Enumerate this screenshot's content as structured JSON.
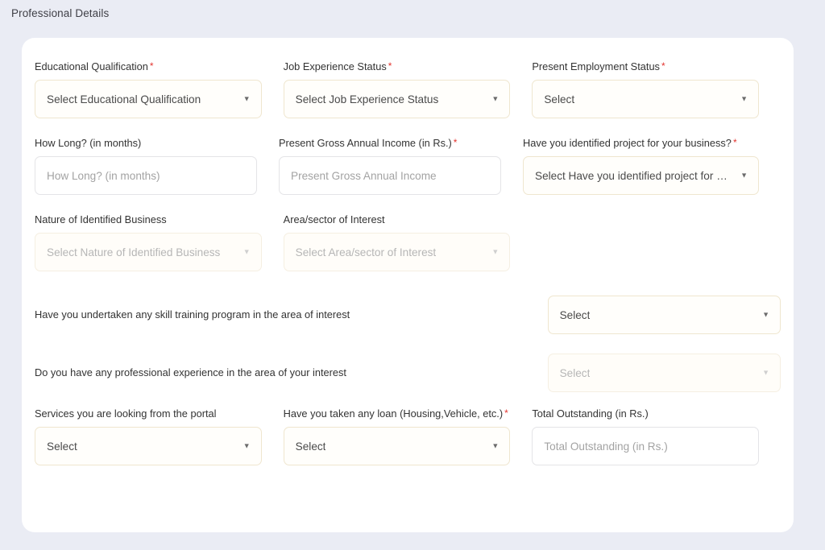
{
  "section": {
    "title": "Professional Details"
  },
  "icons": {
    "caret": "▼"
  },
  "colors": {
    "page_background": "#eaecf4",
    "card_background": "#ffffff",
    "select_border": "#efe6cf",
    "input_border": "#e4e4e7",
    "required_asterisk": "#e3342f",
    "label_text": "#333333",
    "placeholder_text": "#a3a3a3",
    "disabled_text": "#b6b6b6"
  },
  "fields": {
    "educational_qualification": {
      "label": "Educational Qualification",
      "required": "*",
      "value": "Select Educational Qualification",
      "type": "select",
      "state": "enabled"
    },
    "job_experience_status": {
      "label": "Job Experience Status",
      "required": "*",
      "value": "Select Job Experience Status",
      "type": "select",
      "state": "enabled"
    },
    "present_employment_status": {
      "label": "Present Employment Status",
      "required": "*",
      "value": "Select",
      "type": "select",
      "state": "enabled"
    },
    "how_long": {
      "label": "How Long? (in months)",
      "required": "",
      "value": "",
      "placeholder": "How Long? (in months)",
      "type": "text",
      "state": "enabled"
    },
    "present_gross_annual_income": {
      "label": "Present Gross Annual Income (in Rs.)",
      "required": "*",
      "value": "",
      "placeholder": "Present Gross Annual Income",
      "type": "text",
      "state": "enabled"
    },
    "identified_project": {
      "label": "Have you identified project for your business?",
      "required": "*",
      "value": "Select Have you identified project for you…",
      "type": "select",
      "state": "enabled"
    },
    "nature_of_identified_business": {
      "label": "Nature of Identified Business",
      "required": "",
      "value": "Select Nature of Identified Business",
      "type": "select",
      "state": "disabled"
    },
    "area_sector_of_interest": {
      "label": "Area/sector of Interest",
      "required": "",
      "value": "Select Area/sector of Interest",
      "type": "select",
      "state": "disabled"
    },
    "skill_training_program": {
      "label": "Have you undertaken any skill training program in the area of interest",
      "required": "",
      "value": "Select",
      "type": "select",
      "state": "enabled"
    },
    "professional_experience": {
      "label": "Do you have any professional experience in the area of your interest",
      "required": "",
      "value": "Select",
      "type": "select",
      "state": "disabled"
    },
    "services_from_portal": {
      "label": "Services you are looking from the portal",
      "required": "",
      "value": "Select",
      "type": "select",
      "state": "enabled"
    },
    "taken_any_loan": {
      "label": "Have you taken any loan (Housing,Vehicle, etc.)",
      "required": "*",
      "value": "Select",
      "type": "select",
      "state": "enabled"
    },
    "total_outstanding": {
      "label": "Total Outstanding (in Rs.)",
      "required": "",
      "value": "",
      "placeholder": "Total Outstanding (in Rs.)",
      "type": "text",
      "state": "enabled"
    }
  }
}
